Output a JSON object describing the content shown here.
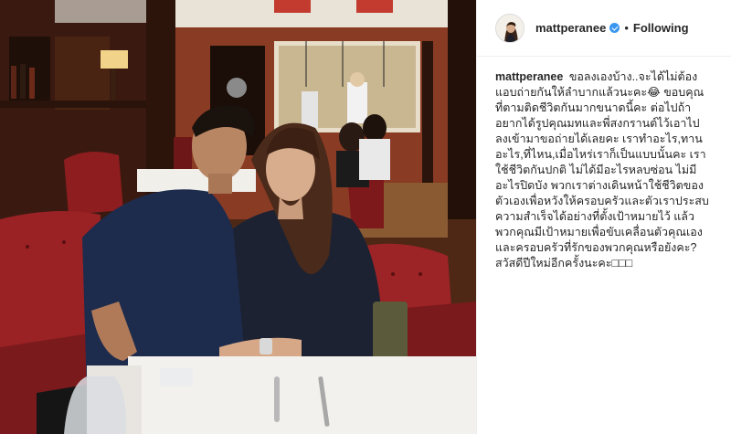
{
  "post": {
    "username": "mattperanee",
    "verified": true,
    "follow_label": "Following",
    "separator": "•",
    "caption_user": "mattperanee",
    "caption_text": "ขอลงเองบ้าง..จะได้ไม่ต้องแอบถ่ายกันให้ลำบากแล้วนะคะ😂 ขอบคุณที่ตามติดชีวิตกันมากขนาดนี้คะ ต่อไปถ้าอยากได้รูปคุณมทและพี่สงกรานต์ไว้เอาไปลงเข้ามาขอถ่ายได้เลยคะ เราทำอะไร,ทานอะไร,ที่ไหน,เมื่อไหร่เราก็เป็นแบบนั้นคะ เราใช้ชีวิตกันปกติ ไม่ได้มีอะไรหลบซ่อน ไม่มีอะไรปิดบัง พวกเราต่างเดินหน้าใช้ชีวิตของตัวเองเพื่อหวังให้ครอบครัวและตัวเราประสบความสำเร็จได้อย่างที่ตั้งเป้าหมายไว้ แล้วพวกคุณมีเป้าหมายเพื่อขับเคลื่อนตัวคุณเองและครอบครัวที่รักของพวกคุณหรือยังคะ? สวัสดีปีใหม่อีกครั้งนะคะ□□□"
  },
  "colors": {
    "verified": "#3897f0",
    "text": "#262626",
    "border": "#efefef"
  },
  "icons": {
    "verified": "verified-badge-icon"
  }
}
